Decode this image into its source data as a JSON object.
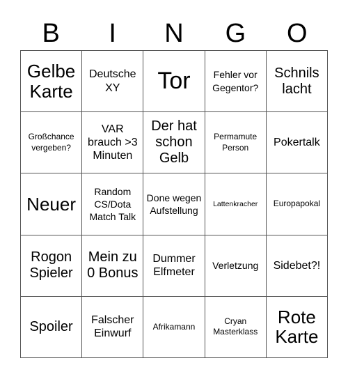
{
  "header": {
    "letters": [
      "B",
      "I",
      "N",
      "G",
      "O"
    ]
  },
  "cells": [
    [
      "Gelbe Karte",
      "Deutsche XY",
      "Tor",
      "Fehler vor Gegentor?",
      "Schnils lacht"
    ],
    [
      "Großchance vergeben?",
      "VAR brauch >3 Minuten",
      "Der hat schon Gelb",
      "Permamute Person",
      "Pokertalk"
    ],
    [
      "Neuer",
      "Random CS/Dota Match Talk",
      "Done wegen Aufstellung",
      "Lattenkracher",
      "Europapokal"
    ],
    [
      "Rogon Spieler",
      "Mein zu 0 Bonus",
      "Dummer Elfmeter",
      "Verletzung",
      "Sidebet?!"
    ],
    [
      "Spoiler",
      "Falscher Einwurf",
      "Afrikamann",
      "Cryan Masterklass",
      "Rote Karte"
    ]
  ]
}
